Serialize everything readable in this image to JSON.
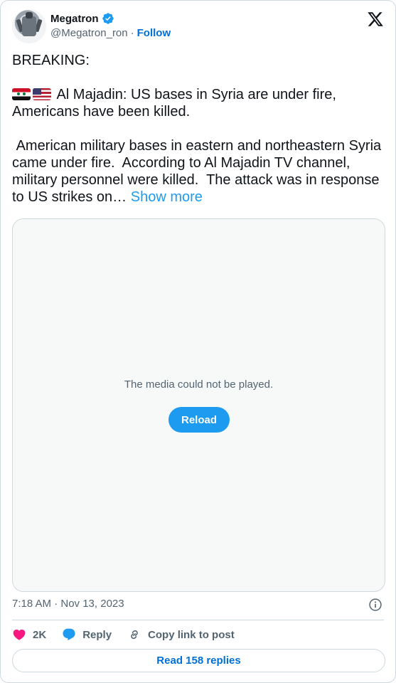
{
  "author": {
    "display_name": "Megatron",
    "handle": "@Megatron_ron",
    "separator": "·",
    "follow_label": "Follow"
  },
  "tweet": {
    "line1": "BREAKING:",
    "line2": " Al Majadin: US bases in Syria are under fire, Americans have been killed.",
    "line3": " American military bases in eastern and northeastern Syria came under fire.  According to Al Majadin TV channel, military personnel were killed.  The attack was in response to US strikes on…",
    "show_more": "Show more",
    "flags": [
      "syria-flag",
      "us-flag"
    ]
  },
  "media": {
    "error_message": "The media could not be played.",
    "reload_label": "Reload"
  },
  "meta": {
    "timestamp": "7:18 AM · Nov 13, 2023"
  },
  "actions": {
    "like_count": "2K",
    "reply_label": "Reply",
    "copy_link_label": "Copy link to post"
  },
  "footer": {
    "read_replies_label": "Read 158 replies"
  },
  "colors": {
    "accent": "#1d9bf0",
    "link": "#006fd6",
    "heart": "#f91880",
    "muted": "#536471",
    "border": "#cfd9de"
  }
}
